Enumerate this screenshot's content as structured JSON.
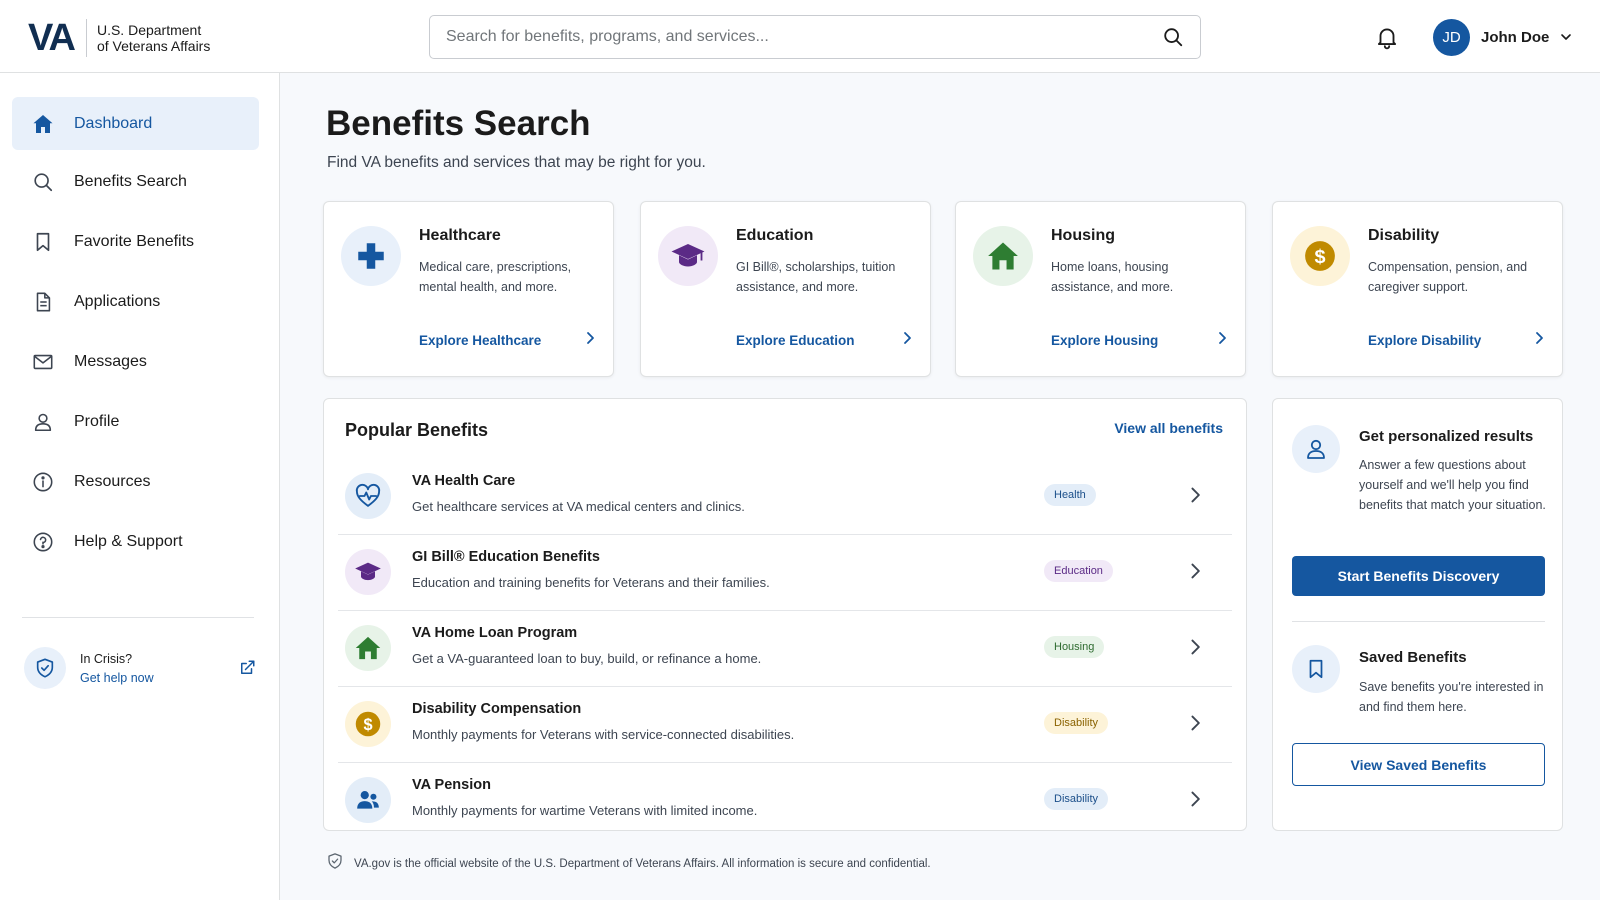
{
  "header": {
    "logo_mark": "VA",
    "logo_line1": "U.S. Department",
    "logo_line2": "of Veterans Affairs",
    "search_placeholder": "Search for benefits, programs, and services...",
    "user_initials": "JD",
    "user_name": "John Doe"
  },
  "sidebar": {
    "items": [
      {
        "label": "Dashboard",
        "icon": "home-icon",
        "active": true
      },
      {
        "label": "Benefits Search",
        "icon": "search-icon"
      },
      {
        "label": "Favorite Benefits",
        "icon": "bookmark-icon"
      },
      {
        "label": "Applications",
        "icon": "document-icon"
      },
      {
        "label": "Messages",
        "icon": "mail-icon"
      },
      {
        "label": "Profile",
        "icon": "person-icon"
      },
      {
        "label": "Resources",
        "icon": "info-icon"
      },
      {
        "label": "Help & Support",
        "icon": "help-icon"
      }
    ],
    "crisis_title": "In Crisis?",
    "crisis_link": "Get help now"
  },
  "main": {
    "title": "Benefits Search",
    "subtitle": "Find VA benefits and services that may be right for you."
  },
  "categories": [
    {
      "title": "Healthcare",
      "desc": "Medical care, prescriptions, mental health, and more.",
      "link": "Explore Healthcare",
      "icon": "medical-cross-icon",
      "color": "#1557a0",
      "bg": "#e8f0fa"
    },
    {
      "title": "Education",
      "desc": "GI Bill®, scholarships, tuition assistance, and more.",
      "link": "Explore Education",
      "icon": "graduation-cap-icon",
      "color": "#5b2a86",
      "bg": "#f1e9f7"
    },
    {
      "title": "Housing",
      "desc": "Home loans, housing assistance, and more.",
      "link": "Explore Housing",
      "icon": "house-icon",
      "color": "#2e7d32",
      "bg": "#e7f3e8"
    },
    {
      "title": "Disability",
      "desc": "Compensation, pension, and caregiver support.",
      "link": "Explore Disability",
      "icon": "dollar-coin-icon",
      "color": "#c08a00",
      "bg": "#fdf3d8"
    }
  ],
  "popular": {
    "title": "Popular Benefits",
    "view_all": "View all benefits",
    "rows": [
      {
        "title": "VA Health Care",
        "desc": "Get healthcare services at VA medical centers and clinics.",
        "tag": "Health",
        "icon": "heart-pulse-icon",
        "tag_color": "#1b4f8a",
        "tag_bg": "#e3edf8",
        "icon_bg": "#e3edf8"
      },
      {
        "title": "GI Bill® Education Benefits",
        "desc": "Education and training benefits for Veterans and their families.",
        "tag": "Education",
        "icon": "graduation-cap-icon",
        "tag_color": "#5b2a86",
        "tag_bg": "#f1e9f7",
        "icon_bg": "#f1e9f7"
      },
      {
        "title": "VA Home Loan Program",
        "desc": "Get a VA-guaranteed loan to buy, build, or refinance a home.",
        "tag": "Housing",
        "icon": "house-icon",
        "tag_color": "#2e6b30",
        "tag_bg": "#e7f3e8",
        "icon_bg": "#e7f3e8"
      },
      {
        "title": "Disability Compensation",
        "desc": "Monthly payments for Veterans with service-connected disabilities.",
        "tag": "Disability",
        "icon": "dollar-coin-icon",
        "tag_color": "#8a6200",
        "tag_bg": "#fdf3d8",
        "icon_bg": "#fdf3d8"
      },
      {
        "title": "VA Pension",
        "desc": "Monthly payments for wartime Veterans with limited income.",
        "tag": "Disability",
        "icon": "people-icon",
        "tag_color": "#1b4f8a",
        "tag_bg": "#e3edf8",
        "icon_bg": "#e3edf8"
      }
    ]
  },
  "panel": {
    "personalized_title": "Get personalized results",
    "personalized_desc": "Answer a few questions about yourself and we'll help you find benefits that match your situation.",
    "start_button": "Start Benefits Discovery",
    "saved_title": "Saved Benefits",
    "saved_desc": "Save benefits you're interested in and find them here.",
    "saved_button": "View Saved Benefits"
  },
  "footer": {
    "note": "VA.gov is the official website of the U.S. Department of Veterans Affairs. All information is secure and confidential."
  },
  "colors": {
    "primary": "#1557a0",
    "navy": "#112e51"
  }
}
